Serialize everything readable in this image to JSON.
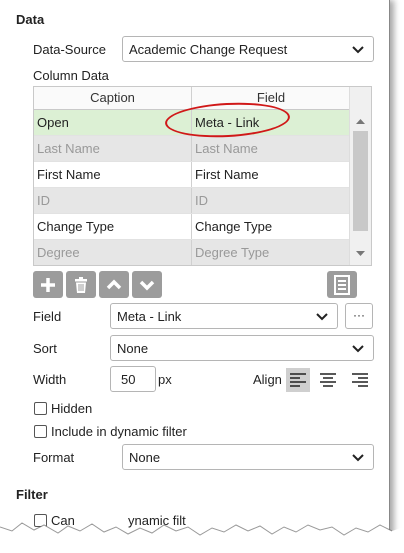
{
  "data_section": {
    "title": "Data"
  },
  "data_source": {
    "label": "Data-Source",
    "value": "Academic Change Request"
  },
  "column_data": {
    "label": "Column Data",
    "headers": [
      "Caption",
      "Field"
    ],
    "rows": [
      {
        "caption": "Open",
        "field": "Meta - Link",
        "state": "selected"
      },
      {
        "caption": "Last Name",
        "field": "Last Name",
        "state": "disabled"
      },
      {
        "caption": "First Name",
        "field": "First Name",
        "state": "normal"
      },
      {
        "caption": "ID",
        "field": "ID",
        "state": "disabled"
      },
      {
        "caption": "Change Type",
        "field": "Change Type",
        "state": "normal"
      },
      {
        "caption": "Degree",
        "field": "Degree Type",
        "state": "disabled"
      }
    ]
  },
  "toolbar": {
    "buttons": [
      "add-icon",
      "trash-icon",
      "chevron-up-icon",
      "chevron-down-icon"
    ],
    "right_button": "list-icon",
    "color": "#9c9c9c"
  },
  "field": {
    "label": "Field",
    "value": "Meta - Link",
    "more": "···"
  },
  "sort": {
    "label": "Sort",
    "value": "None"
  },
  "width": {
    "label": "Width",
    "value": "50",
    "unit": "px"
  },
  "align": {
    "label": "Align",
    "options": [
      "align-left-icon",
      "align-center-icon",
      "align-right-icon"
    ],
    "selected": "align-left-icon"
  },
  "hidden": {
    "label": "Hidden",
    "checked": false
  },
  "dynamic": {
    "label": "Include in dynamic filter",
    "checked": false
  },
  "format": {
    "label": "Format",
    "value": "None"
  },
  "filter_section": {
    "title": "Filter",
    "partial_label": "Can",
    "partial_label_2": "ynamic filt"
  },
  "colors": {
    "selected_row": "#dcf0d4",
    "disabled_row": "#e6e6e6",
    "highlight": "#d01818"
  }
}
